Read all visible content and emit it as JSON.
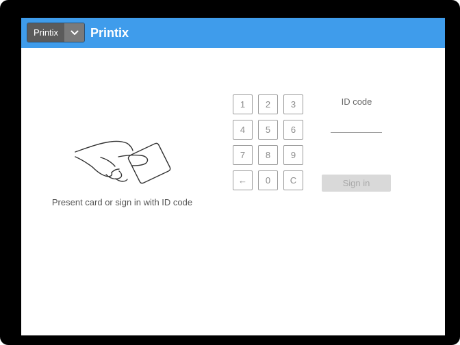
{
  "header": {
    "dropdown_label": "Printix",
    "dropdown_icon": "chevron-down-icon",
    "title": "Printix",
    "bar_color": "#3f9ceb"
  },
  "login": {
    "illustration_icon": "hand-holding-card-icon",
    "instruction": "Present card or sign in with ID code",
    "keypad": {
      "keys": [
        "1",
        "2",
        "3",
        "4",
        "5",
        "6",
        "7",
        "8",
        "9",
        "←",
        "0",
        "C"
      ]
    },
    "id_code_label": "ID code",
    "id_code_value": "",
    "sign_in_label": "Sign in"
  }
}
